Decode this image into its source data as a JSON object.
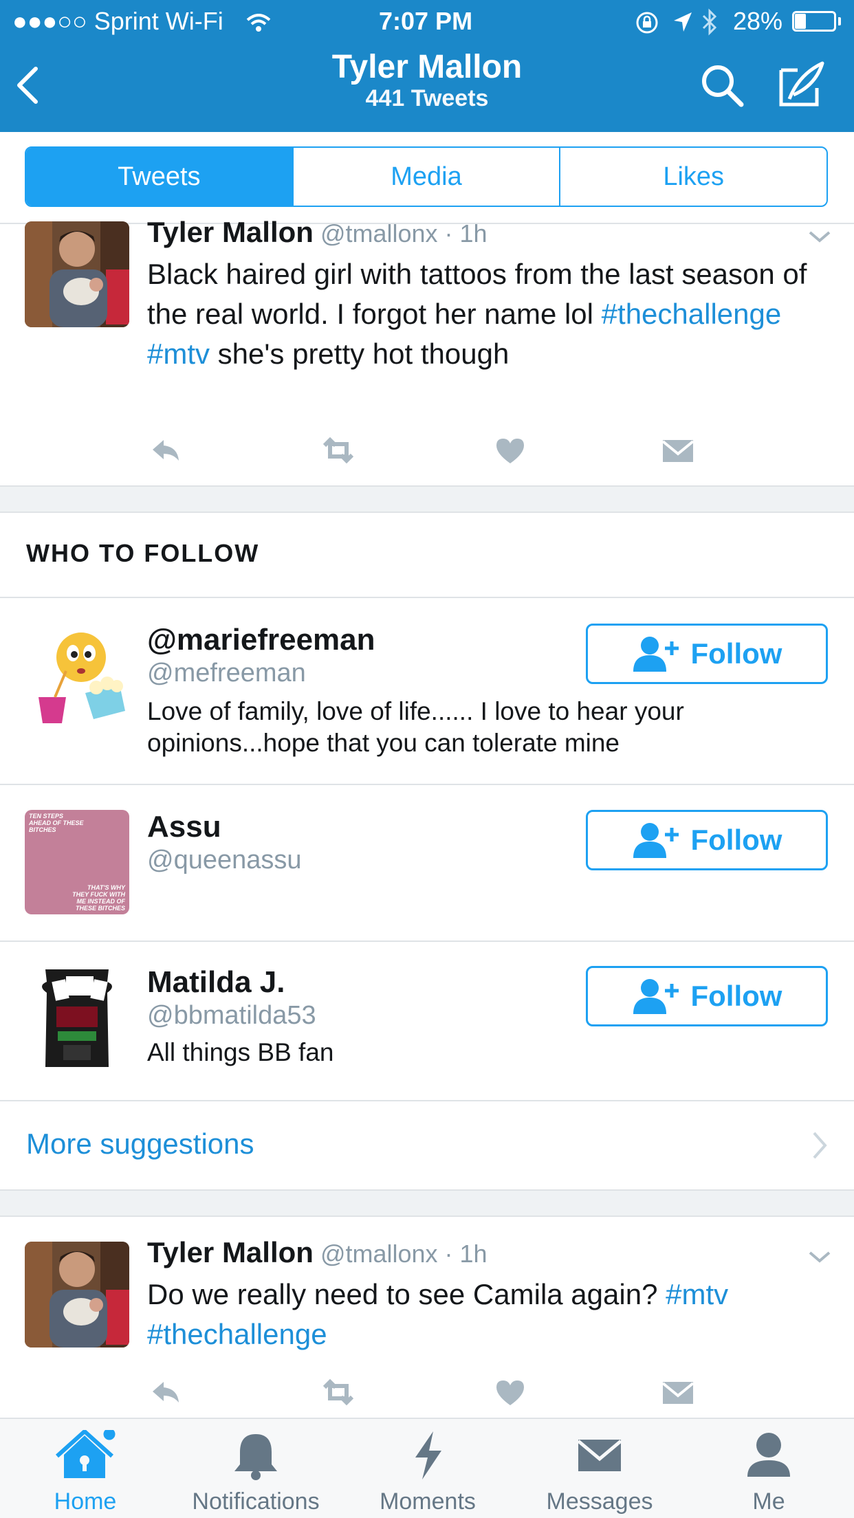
{
  "status_bar": {
    "carrier": "●●●○○ Sprint Wi-Fi",
    "time": "7:07 PM",
    "battery": "28%"
  },
  "nav": {
    "title": "Tyler Mallon",
    "subtitle": "441 Tweets",
    "back_icon": "chevron-left-icon",
    "search_icon": "search-icon",
    "compose_icon": "compose-icon"
  },
  "tabs": [
    {
      "label": "Tweets",
      "active": true
    },
    {
      "label": "Media",
      "active": false
    },
    {
      "label": "Likes",
      "active": false
    }
  ],
  "tweets": [
    {
      "name": "Tyler Mallon",
      "meta": "@tmallonx · 1h",
      "body_parts": [
        "Black haired girl with tattoos from the last season of the real world. I forgot her name lol ",
        "#thechallenge",
        " ",
        "#mtv",
        " she's pretty hot though"
      ]
    },
    {
      "name": "Tyler Mallon",
      "meta": "@tmallonx · 1h",
      "body_parts": [
        "Do we really need to see Camila again? ",
        "#mtv",
        " ",
        "#thechallenge"
      ]
    }
  ],
  "who_to_follow": {
    "title": "WHO TO FOLLOW",
    "follow_label": "Follow",
    "suggestions": [
      {
        "name": "@mariefreeman",
        "handle": "@mefreeman",
        "bio": "Love of family, love of life...... I love to hear your opinions...hope that you can tolerate mine"
      },
      {
        "name": "Assu",
        "handle": "@queenassu",
        "bio": ""
      },
      {
        "name": "Matilda J.",
        "handle": "@bbmatilda53",
        "bio": "All things BB fan"
      }
    ],
    "more_label": "More suggestions"
  },
  "assu_avatar_text": {
    "top": "TEN STEPS AHEAD OF THESE BITCHES",
    "bottom": "THAT'S WHY THEY FUCK WITH ME INSTEAD OF THESE BITCHES"
  },
  "tabbar": [
    {
      "label": "Home",
      "icon": "home-icon",
      "active": true
    },
    {
      "label": "Notifications",
      "icon": "bell-icon",
      "active": false
    },
    {
      "label": "Moments",
      "icon": "lightning-icon",
      "active": false
    },
    {
      "label": "Messages",
      "icon": "envelope-icon",
      "active": false
    },
    {
      "label": "Me",
      "icon": "person-icon",
      "active": false
    }
  ],
  "colors": {
    "header": "#1b88c9",
    "accent": "#1da1f2",
    "muted": "#8899a6"
  }
}
